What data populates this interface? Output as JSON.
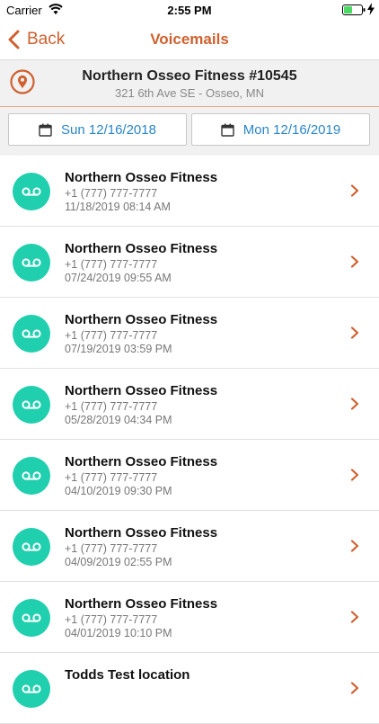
{
  "status_bar": {
    "carrier": "Carrier",
    "time": "2:55 PM"
  },
  "nav": {
    "back_label": "Back",
    "title": "Voicemails"
  },
  "location": {
    "name": "Northern Osseo Fitness #10545",
    "address": "321 6th Ave SE - Osseo, MN"
  },
  "date_filter": {
    "start": "Sun 12/16/2018",
    "end": "Mon 12/16/2019"
  },
  "colors": {
    "accent": "#d0602e",
    "link": "#2a86c8",
    "avatar": "#1fcfae"
  },
  "voicemails": [
    {
      "name": "Northern Osseo Fitness",
      "phone": "+1 (777) 777-7777",
      "date": "11/18/2019 08:14 AM"
    },
    {
      "name": "Northern Osseo Fitness",
      "phone": "+1 (777) 777-7777",
      "date": "07/24/2019 09:55 AM"
    },
    {
      "name": "Northern Osseo Fitness",
      "phone": "+1 (777) 777-7777",
      "date": "07/19/2019 03:59 PM"
    },
    {
      "name": "Northern Osseo Fitness",
      "phone": "+1 (777) 777-7777",
      "date": "05/28/2019 04:34 PM"
    },
    {
      "name": "Northern Osseo Fitness",
      "phone": "+1 (777) 777-7777",
      "date": "04/10/2019 09:30 PM"
    },
    {
      "name": "Northern Osseo Fitness",
      "phone": "+1 (777) 777-7777",
      "date": "04/09/2019 02:55 PM"
    },
    {
      "name": "Northern Osseo Fitness",
      "phone": "+1 (777) 777-7777",
      "date": "04/01/2019 10:10 PM"
    },
    {
      "name": "Todds Test location",
      "phone": "",
      "date": ""
    }
  ]
}
